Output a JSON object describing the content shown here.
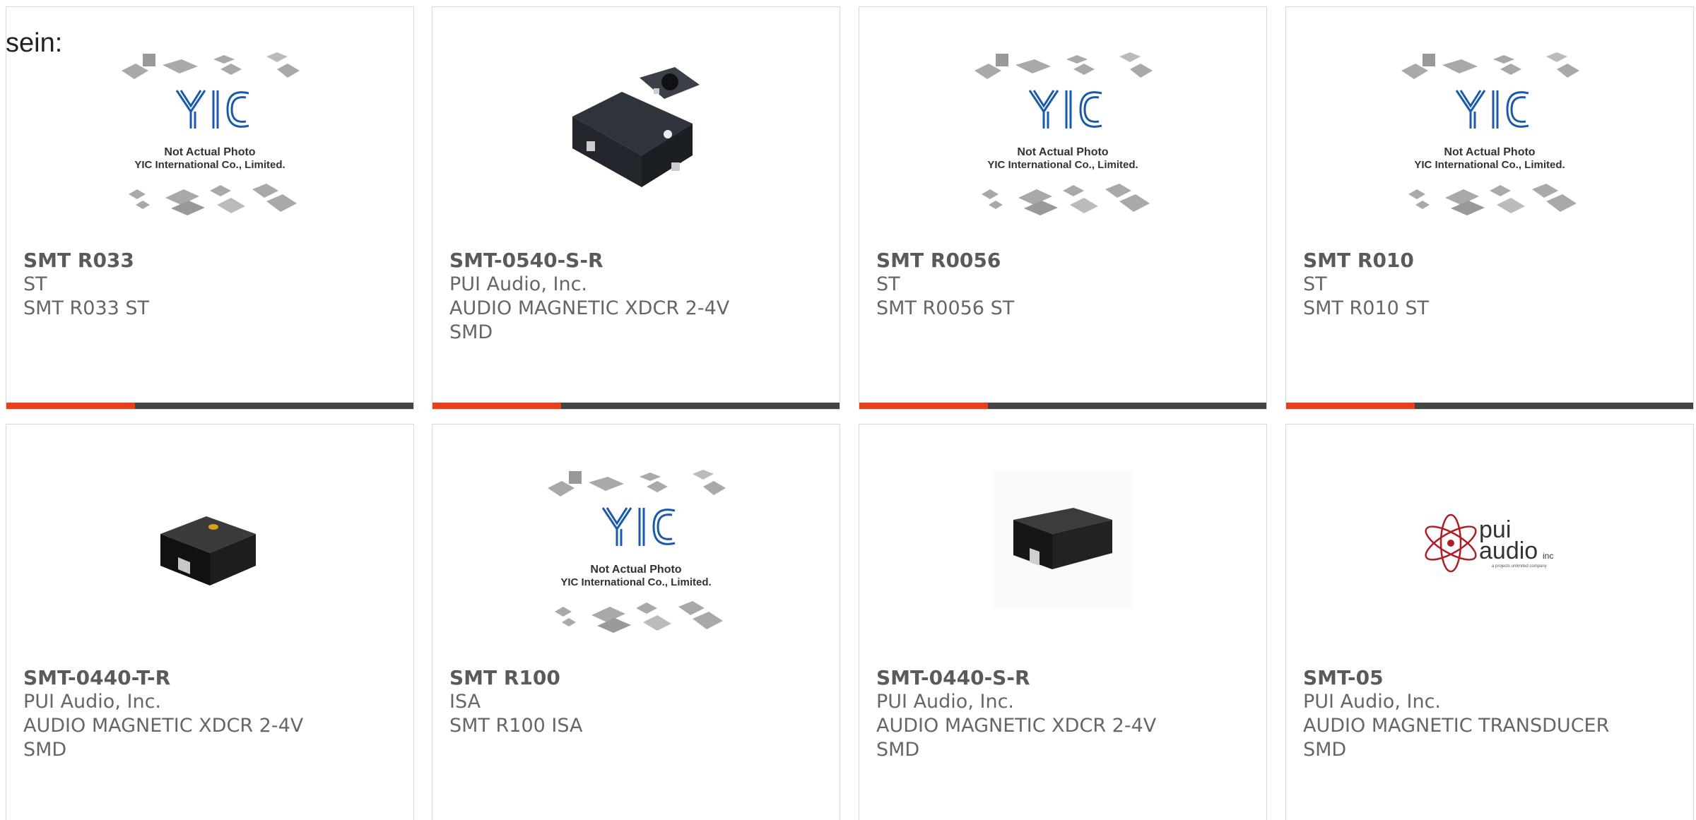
{
  "page": {
    "heading": "sein:"
  },
  "theme": {
    "accent": "#e8401c",
    "bar": "#444444",
    "border": "#d9d9d9",
    "text": "#666666"
  },
  "products": [
    {
      "part": "SMT R033",
      "manufacturer": "ST",
      "description": "SMT R033 ST",
      "description2": "",
      "image": "placeholder-not-actual-photo",
      "placeholder_line1": "Not Actual Photo",
      "placeholder_line2": "YIC International Co., Limited."
    },
    {
      "part": "SMT-0540-S-R",
      "manufacturer": "PUI Audio, Inc.",
      "description": "AUDIO MAGNETIC XDCR 2-4V",
      "description2": "SMD",
      "image": "smd-buzzer-photo"
    },
    {
      "part": "SMT R0056",
      "manufacturer": "ST",
      "description": "SMT R0056 ST",
      "description2": "",
      "image": "placeholder-not-actual-photo",
      "placeholder_line1": "Not Actual Photo",
      "placeholder_line2": "YIC International Co., Limited."
    },
    {
      "part": "SMT R010",
      "manufacturer": "ST",
      "description": "SMT R010 ST",
      "description2": "",
      "image": "placeholder-not-actual-photo",
      "placeholder_line1": "Not Actual Photo",
      "placeholder_line2": "YIC International Co., Limited."
    },
    {
      "part": "SMT-0440-T-R",
      "manufacturer": "PUI Audio, Inc.",
      "description": "AUDIO MAGNETIC XDCR 2-4V",
      "description2": "SMD",
      "image": "smd-transducer-photo"
    },
    {
      "part": "SMT R100",
      "manufacturer": "ISA",
      "description": "SMT R100 ISA",
      "description2": "",
      "image": "placeholder-not-actual-photo",
      "placeholder_line1": "Not Actual Photo",
      "placeholder_line2": "YIC International Co., Limited."
    },
    {
      "part": "SMT-0440-S-R",
      "manufacturer": "PUI Audio, Inc.",
      "description": "AUDIO MAGNETIC XDCR 2-4V",
      "description2": "SMD",
      "image": "smd-transducer-photo"
    },
    {
      "part": "SMT-05",
      "manufacturer": "PUI Audio, Inc.",
      "description": "AUDIO MAGNETIC TRANSDUCER",
      "description2": "SMD",
      "image": "pui-audio-logo",
      "logo_line1": "pui",
      "logo_line2": "audio",
      "logo_suffix": "inc",
      "logo_tagline": "a projects unlimited company"
    }
  ]
}
